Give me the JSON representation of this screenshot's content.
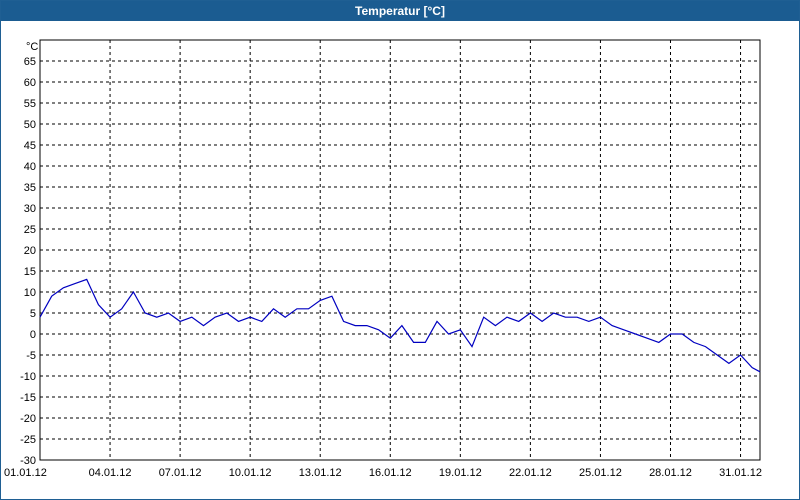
{
  "window": {
    "title": "Temperatur [°C]"
  },
  "chart_data": {
    "type": "line",
    "title": "Temperatur [°C]",
    "ylabel": "°C",
    "ylim": [
      -30,
      70
    ],
    "yticks": [
      -30,
      -25,
      -20,
      -15,
      -10,
      -5,
      0,
      5,
      10,
      15,
      20,
      25,
      30,
      35,
      40,
      45,
      50,
      55,
      60,
      65
    ],
    "y_unit_label": "°C",
    "xlim": [
      "01.01.12",
      "31.01.12"
    ],
    "xticks": [
      "01.01.12",
      "04.01.12",
      "07.01.12",
      "10.01.12",
      "13.01.12",
      "16.01.12",
      "19.01.12",
      "22.01.12",
      "25.01.12",
      "28.01.12",
      "31.01.12"
    ],
    "grid": true,
    "series": [
      {
        "color": "#0000c0",
        "x": [
          "01.01.12 00:00",
          "01.01.12 12:00",
          "02.01.12 00:00",
          "02.01.12 12:00",
          "03.01.12 00:00",
          "03.01.12 12:00",
          "04.01.12 00:00",
          "04.01.12 12:00",
          "05.01.12 00:00",
          "05.01.12 12:00",
          "06.01.12 00:00",
          "06.01.12 12:00",
          "07.01.12 00:00",
          "07.01.12 12:00",
          "08.01.12 00:00",
          "08.01.12 12:00",
          "09.01.12 00:00",
          "09.01.12 12:00",
          "10.01.12 00:00",
          "10.01.12 12:00",
          "11.01.12 00:00",
          "11.01.12 12:00",
          "12.01.12 00:00",
          "12.01.12 12:00",
          "13.01.12 00:00",
          "13.01.12 12:00",
          "14.01.12 00:00",
          "14.01.12 12:00",
          "15.01.12 00:00",
          "15.01.12 12:00",
          "16.01.12 00:00",
          "16.01.12 12:00",
          "17.01.12 00:00",
          "17.01.12 12:00",
          "18.01.12 00:00",
          "18.01.12 12:00",
          "19.01.12 00:00",
          "19.01.12 12:00",
          "20.01.12 00:00",
          "20.01.12 12:00",
          "21.01.12 00:00",
          "21.01.12 12:00",
          "22.01.12 00:00",
          "22.01.12 12:00",
          "23.01.12 00:00",
          "23.01.12 12:00",
          "24.01.12 00:00",
          "24.01.12 12:00",
          "25.01.12 00:00",
          "25.01.12 12:00",
          "26.01.12 00:00",
          "26.01.12 12:00",
          "27.01.12 00:00",
          "27.01.12 12:00",
          "28.01.12 00:00",
          "28.01.12 12:00",
          "29.01.12 00:00",
          "29.01.12 12:00",
          "30.01.12 00:00",
          "30.01.12 12:00",
          "31.01.12 00:00",
          "31.01.12 12:00",
          "31.01.12 20:00"
        ],
        "values": [
          4,
          9,
          11,
          12,
          13,
          7,
          4,
          6,
          10,
          5,
          4,
          5,
          3,
          4,
          2,
          4,
          5,
          3,
          4,
          3,
          6,
          4,
          6,
          6,
          8,
          9,
          3,
          2,
          2,
          1,
          -1,
          2,
          -2,
          -2,
          3,
          0,
          1,
          -3,
          4,
          2,
          4,
          3,
          5,
          3,
          5,
          4,
          4,
          3,
          4,
          2,
          1,
          0,
          -1,
          -2,
          0,
          0,
          -2,
          -3,
          -5,
          -7,
          -5,
          -8,
          -9
        ]
      }
    ]
  }
}
